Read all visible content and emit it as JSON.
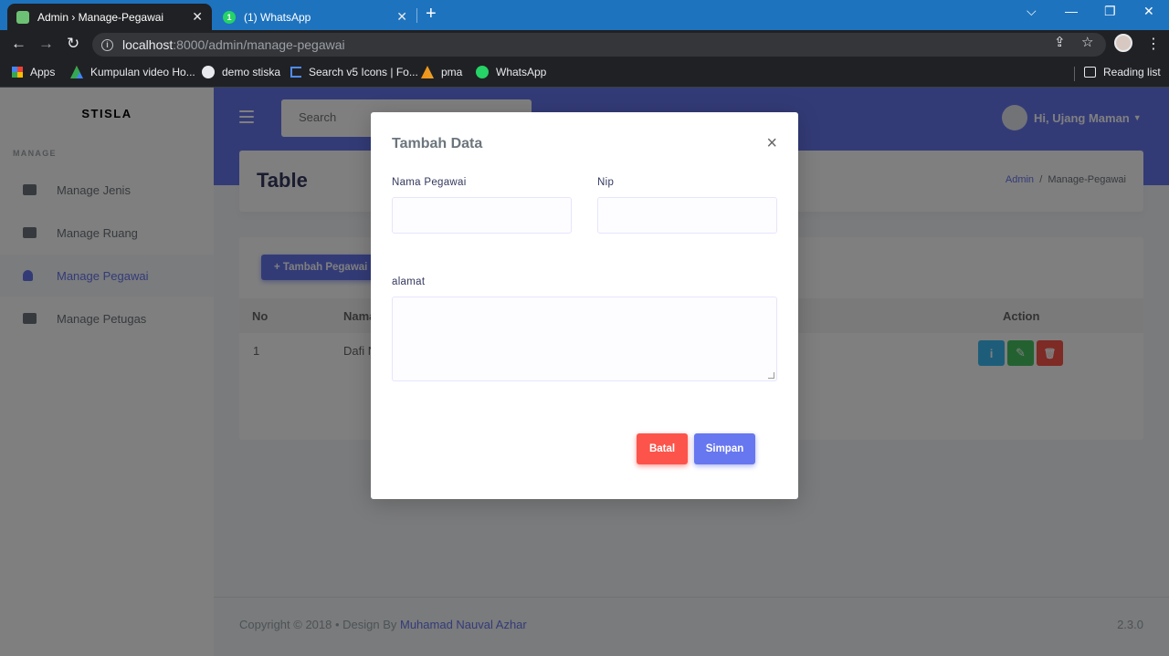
{
  "browser": {
    "tabs": [
      {
        "title": "Admin › Manage-Pegawai",
        "close": "✕"
      },
      {
        "title": "(1) WhatsApp",
        "close": "✕",
        "badge": "1"
      }
    ],
    "new_tab": "+",
    "window_controls": {
      "dropdown": "⌵",
      "minimize": "—",
      "restore": "❐",
      "close": "✕"
    },
    "nav": {
      "back": "←",
      "forward": "→",
      "reload": "↻"
    },
    "url_host": "localhost",
    "url_rest": ":8000/admin/manage-pegawai",
    "info": "i",
    "share": "⇪",
    "star": "☆",
    "menu": "⋮",
    "bookmarks": [
      "Apps",
      "Kumpulan video Ho...",
      "demo stiska",
      "Search v5 Icons | Fo...",
      "pma",
      "WhatsApp"
    ],
    "reading_list": "Reading list"
  },
  "app": {
    "brand": "STISLA",
    "menu_header": "MANAGE",
    "sidebar_items": [
      "Manage Jenis",
      "Manage Ruang",
      "Manage Pegawai",
      "Manage Petugas"
    ],
    "search_placeholder": "Search",
    "user_greeting": "Hi, Ujang Maman",
    "caret": "▼"
  },
  "section": {
    "title": "Table",
    "breadcrumb_link": "Admin",
    "breadcrumb_sep": "/",
    "breadcrumb_current": "Manage-Pegawai"
  },
  "card": {
    "add_button": "+ Tambah Pegawai",
    "headers": {
      "no": "No",
      "nama": "Nama",
      "action": "Action"
    },
    "rows": [
      {
        "no": "1",
        "nama": "Dafi N"
      }
    ],
    "action_icons": {
      "info": "i",
      "edit": "✎",
      "delete": "🗑"
    }
  },
  "footer": {
    "copyright": "Copyright © 2018  •  Design By ",
    "author": "Muhamad Nauval Azhar",
    "version": "2.3.0"
  },
  "modal": {
    "title": "Tambah Data",
    "close": "×",
    "label_nama": "Nama Pegawai",
    "label_nip": "Nip",
    "label_alamat": "alamat",
    "batal": "Batal",
    "simpan": "Simpan"
  },
  "colors": {
    "primary": "#6777ef",
    "danger": "#fc544b",
    "info": "#3abaf4",
    "success": "#47c363",
    "browser_tab_bar": "#1e73be"
  }
}
